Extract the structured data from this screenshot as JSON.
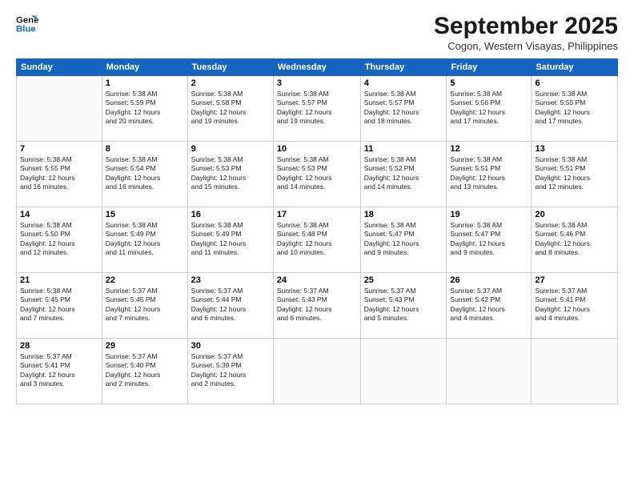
{
  "header": {
    "logo_line1": "General",
    "logo_line2": "Blue",
    "month": "September 2025",
    "location": "Cogon, Western Visayas, Philippines"
  },
  "days_of_week": [
    "Sunday",
    "Monday",
    "Tuesday",
    "Wednesday",
    "Thursday",
    "Friday",
    "Saturday"
  ],
  "weeks": [
    [
      {
        "day": "",
        "text": ""
      },
      {
        "day": "1",
        "text": "Sunrise: 5:38 AM\nSunset: 5:59 PM\nDaylight: 12 hours\nand 20 minutes."
      },
      {
        "day": "2",
        "text": "Sunrise: 5:38 AM\nSunset: 5:58 PM\nDaylight: 12 hours\nand 19 minutes."
      },
      {
        "day": "3",
        "text": "Sunrise: 5:38 AM\nSunset: 5:57 PM\nDaylight: 12 hours\nand 19 minutes."
      },
      {
        "day": "4",
        "text": "Sunrise: 5:38 AM\nSunset: 5:57 PM\nDaylight: 12 hours\nand 18 minutes."
      },
      {
        "day": "5",
        "text": "Sunrise: 5:38 AM\nSunset: 5:56 PM\nDaylight: 12 hours\nand 17 minutes."
      },
      {
        "day": "6",
        "text": "Sunrise: 5:38 AM\nSunset: 5:55 PM\nDaylight: 12 hours\nand 17 minutes."
      }
    ],
    [
      {
        "day": "7",
        "text": "Sunrise: 5:38 AM\nSunset: 5:55 PM\nDaylight: 12 hours\nand 16 minutes."
      },
      {
        "day": "8",
        "text": "Sunrise: 5:38 AM\nSunset: 5:54 PM\nDaylight: 12 hours\nand 16 minutes."
      },
      {
        "day": "9",
        "text": "Sunrise: 5:38 AM\nSunset: 5:53 PM\nDaylight: 12 hours\nand 15 minutes."
      },
      {
        "day": "10",
        "text": "Sunrise: 5:38 AM\nSunset: 5:53 PM\nDaylight: 12 hours\nand 14 minutes."
      },
      {
        "day": "11",
        "text": "Sunrise: 5:38 AM\nSunset: 5:52 PM\nDaylight: 12 hours\nand 14 minutes."
      },
      {
        "day": "12",
        "text": "Sunrise: 5:38 AM\nSunset: 5:51 PM\nDaylight: 12 hours\nand 13 minutes."
      },
      {
        "day": "13",
        "text": "Sunrise: 5:38 AM\nSunset: 5:51 PM\nDaylight: 12 hours\nand 12 minutes."
      }
    ],
    [
      {
        "day": "14",
        "text": "Sunrise: 5:38 AM\nSunset: 5:50 PM\nDaylight: 12 hours\nand 12 minutes."
      },
      {
        "day": "15",
        "text": "Sunrise: 5:38 AM\nSunset: 5:49 PM\nDaylight: 12 hours\nand 11 minutes."
      },
      {
        "day": "16",
        "text": "Sunrise: 5:38 AM\nSunset: 5:49 PM\nDaylight: 12 hours\nand 11 minutes."
      },
      {
        "day": "17",
        "text": "Sunrise: 5:38 AM\nSunset: 5:48 PM\nDaylight: 12 hours\nand 10 minutes."
      },
      {
        "day": "18",
        "text": "Sunrise: 5:38 AM\nSunset: 5:47 PM\nDaylight: 12 hours\nand 9 minutes."
      },
      {
        "day": "19",
        "text": "Sunrise: 5:38 AM\nSunset: 5:47 PM\nDaylight: 12 hours\nand 9 minutes."
      },
      {
        "day": "20",
        "text": "Sunrise: 5:38 AM\nSunset: 5:46 PM\nDaylight: 12 hours\nand 8 minutes."
      }
    ],
    [
      {
        "day": "21",
        "text": "Sunrise: 5:38 AM\nSunset: 5:45 PM\nDaylight: 12 hours\nand 7 minutes."
      },
      {
        "day": "22",
        "text": "Sunrise: 5:37 AM\nSunset: 5:45 PM\nDaylight: 12 hours\nand 7 minutes."
      },
      {
        "day": "23",
        "text": "Sunrise: 5:37 AM\nSunset: 5:44 PM\nDaylight: 12 hours\nand 6 minutes."
      },
      {
        "day": "24",
        "text": "Sunrise: 5:37 AM\nSunset: 5:43 PM\nDaylight: 12 hours\nand 6 minutes."
      },
      {
        "day": "25",
        "text": "Sunrise: 5:37 AM\nSunset: 5:43 PM\nDaylight: 12 hours\nand 5 minutes."
      },
      {
        "day": "26",
        "text": "Sunrise: 5:37 AM\nSunset: 5:42 PM\nDaylight: 12 hours\nand 4 minutes."
      },
      {
        "day": "27",
        "text": "Sunrise: 5:37 AM\nSunset: 5:41 PM\nDaylight: 12 hours\nand 4 minutes."
      }
    ],
    [
      {
        "day": "28",
        "text": "Sunrise: 5:37 AM\nSunset: 5:41 PM\nDaylight: 12 hours\nand 3 minutes."
      },
      {
        "day": "29",
        "text": "Sunrise: 5:37 AM\nSunset: 5:40 PM\nDaylight: 12 hours\nand 2 minutes."
      },
      {
        "day": "30",
        "text": "Sunrise: 5:37 AM\nSunset: 5:39 PM\nDaylight: 12 hours\nand 2 minutes."
      },
      {
        "day": "",
        "text": ""
      },
      {
        "day": "",
        "text": ""
      },
      {
        "day": "",
        "text": ""
      },
      {
        "day": "",
        "text": ""
      }
    ]
  ]
}
